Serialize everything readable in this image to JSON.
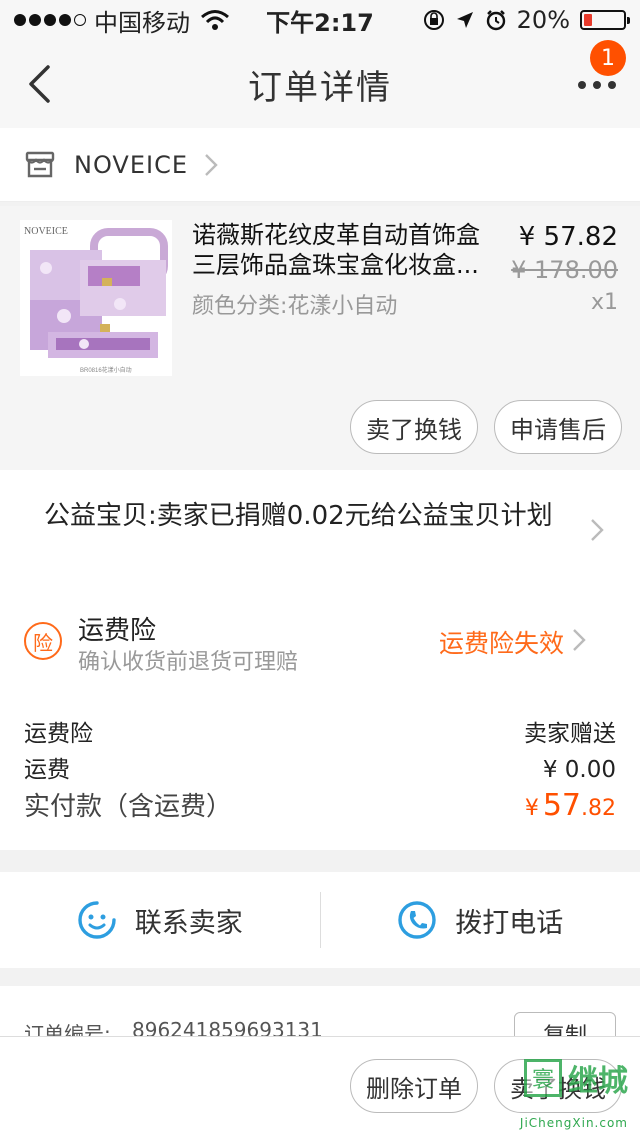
{
  "status_bar": {
    "carrier": "中国移动",
    "time": "下午2:17",
    "battery": "20%",
    "battery_level": 0.2,
    "icons": [
      "wifi-icon",
      "rotation-lock-icon",
      "location-icon",
      "alarm-icon"
    ]
  },
  "nav": {
    "title": "订单详情",
    "badge": "1"
  },
  "shop": {
    "name": "NOVEICE"
  },
  "item": {
    "title_line1": "诺薇斯花纹皮革自动首饰盒",
    "title_line2": "三层饰品盒珠宝盒化妆盒...",
    "spec": "颜色分类:花漾小自动",
    "price": "¥ 57.82",
    "original_price": "¥ 178.00",
    "quantity": "x1",
    "thumb_brand": "NOVEICE",
    "thumb_caption": "BR0816花漾小自动",
    "buttons": {
      "sell_label": "卖了换钱",
      "aftersale_label": "申请售后"
    }
  },
  "charity": {
    "text": "公益宝贝:卖家已捐赠0.02元给公益宝贝计划"
  },
  "insurance": {
    "icon_text": "险",
    "title": "运费险",
    "subtitle": "确认收货前退货可理赔",
    "status": "运费险失效"
  },
  "fees": {
    "rows": [
      {
        "label": "运费险",
        "value": "卖家赠送"
      },
      {
        "label": "运费",
        "value": "¥ 0.00"
      }
    ],
    "total_label": "实付款（含运费）",
    "total_currency": "¥",
    "total_int": "57",
    "total_dec": ".82"
  },
  "contact": {
    "seller_label": "联系卖家",
    "call_label": "拨打电话"
  },
  "order": {
    "number_label": "订单编号:",
    "number": "896241859693131",
    "copy_label": "复制"
  },
  "bottom": {
    "delete_label": "删除订单",
    "sell_label": "卖了换钱"
  },
  "watermark": {
    "box": "寰",
    "text": "继城",
    "url": "JiChengXin.com"
  },
  "colors": {
    "accent": "#ff5000",
    "orange": "#ff6a1a",
    "contact_blue": "#2d9ee0"
  }
}
